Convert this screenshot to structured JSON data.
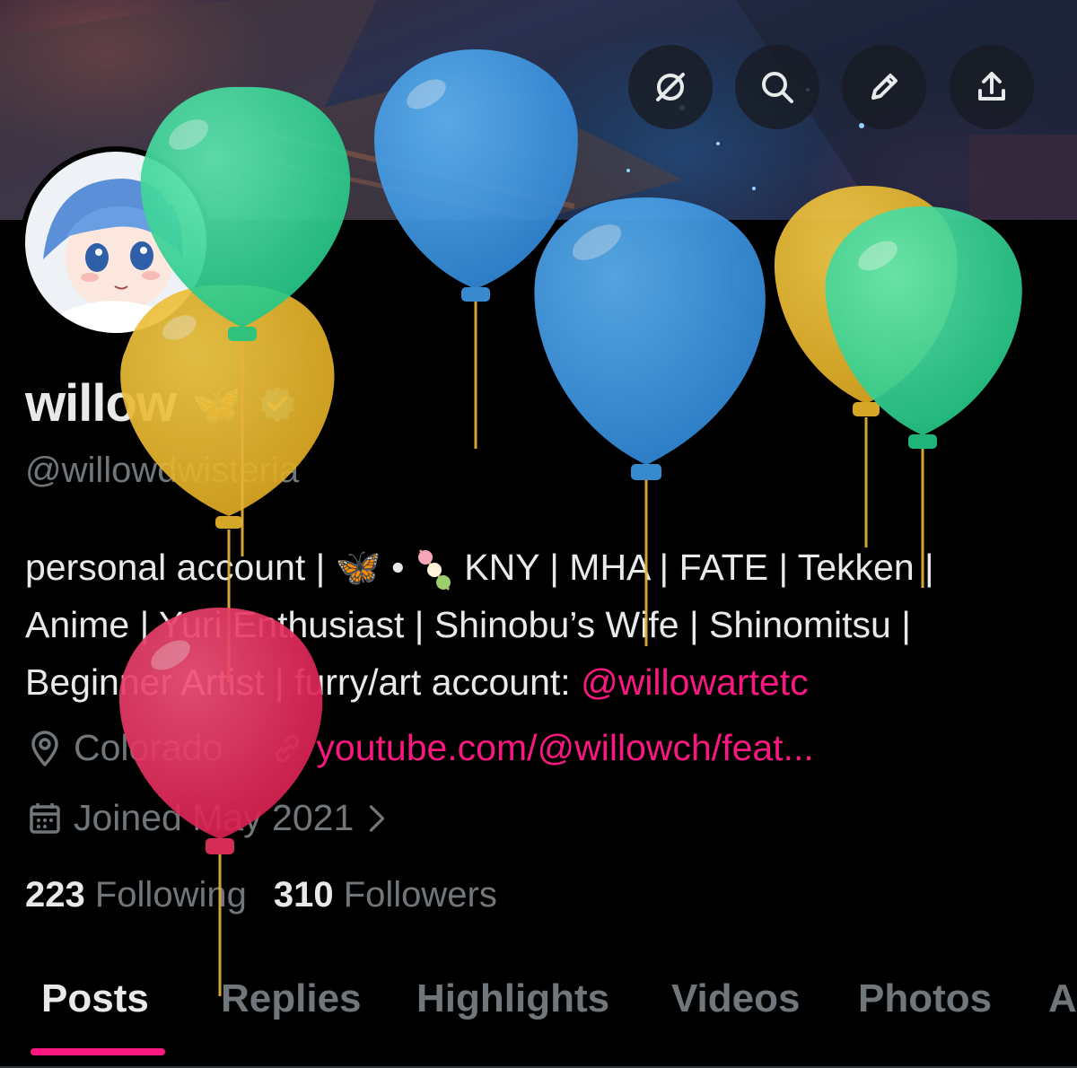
{
  "profile": {
    "display_name": "willow",
    "name_emojis": [
      "butterfly",
      "verified-flower-badge"
    ],
    "handle": "@willowdwisteria",
    "bio": {
      "line1": "personal account | ",
      "line1_emoji": "🦋",
      "line1_sep": " • ",
      "line1_rest": " KNY | MHA | FATE | Tekken |",
      "line2": "Anime | Yuri Enthusiast | Shinobu’s Wife | Shinomitsu |",
      "line3": "Beginner Artist | furry/art account: ",
      "line3_mention": "@willowartetc"
    },
    "location": "Colorado",
    "website": "youtube.com/@willowch/feat...",
    "joined": "Joined May 2021",
    "following_count": "223",
    "following_label": " Following",
    "followers_count": "310",
    "followers_label": " Followers"
  },
  "actions": [
    {
      "icon": "grok-icon"
    },
    {
      "icon": "search-icon"
    },
    {
      "icon": "edit-pencil-icon"
    },
    {
      "icon": "share-upload-icon"
    }
  ],
  "tabs": [
    "Posts",
    "Replies",
    "Highlights",
    "Videos",
    "Photos",
    "A"
  ],
  "active_tab": "Posts",
  "colors": {
    "accent": "#f91880",
    "muted": "#71767b",
    "text": "#e7e9ea",
    "background": "#000000"
  },
  "overlay": {
    "balloon_colors": [
      "#2ecf8e",
      "#3c96e0",
      "#e9b52a",
      "#e8305e"
    ]
  }
}
